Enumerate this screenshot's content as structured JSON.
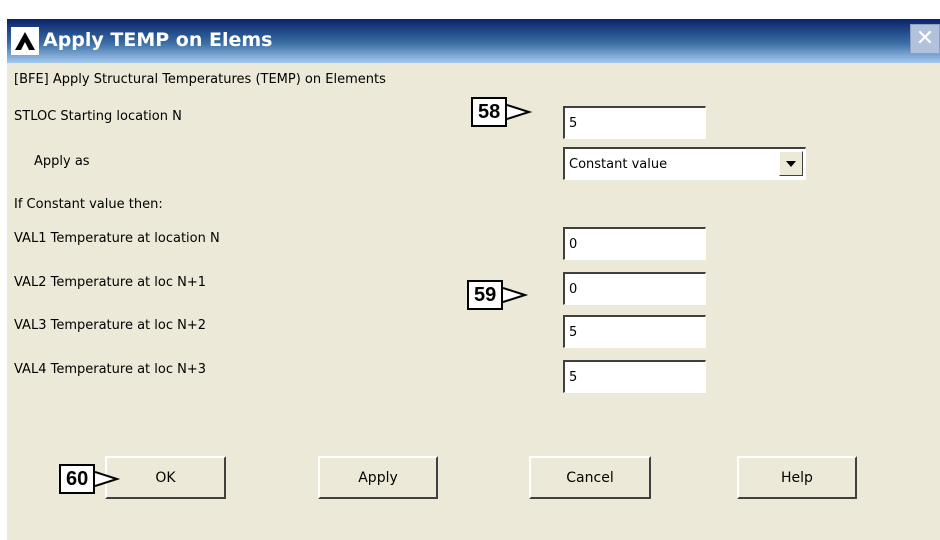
{
  "window": {
    "title": "Apply TEMP on Elems"
  },
  "header_text": "[BFE] Apply Structural Temperatures (TEMP) on Elements",
  "stloc": {
    "label": "STLOC  Starting location N",
    "value": "5"
  },
  "apply_as": {
    "label": "Apply as",
    "selected": "Constant value"
  },
  "if_constant_label": "If Constant value then:",
  "vals": [
    {
      "label": "VAL1   Temperature at location N",
      "value": "0"
    },
    {
      "label": "VAL2   Temperature at loc N+1",
      "value": "0"
    },
    {
      "label": "VAL3   Temperature at loc N+2",
      "value": "5"
    },
    {
      "label": "VAL4   Temperature at loc N+3",
      "value": "5"
    }
  ],
  "buttons": {
    "ok": "OK",
    "apply": "Apply",
    "cancel": "Cancel",
    "help": "Help"
  },
  "callouts": {
    "c58": "58",
    "c59": "59",
    "c60": "60"
  },
  "icons": {
    "title_icon": "ansys-logo-icon",
    "close": "close-icon",
    "dropdown": "chevron-down-icon"
  }
}
